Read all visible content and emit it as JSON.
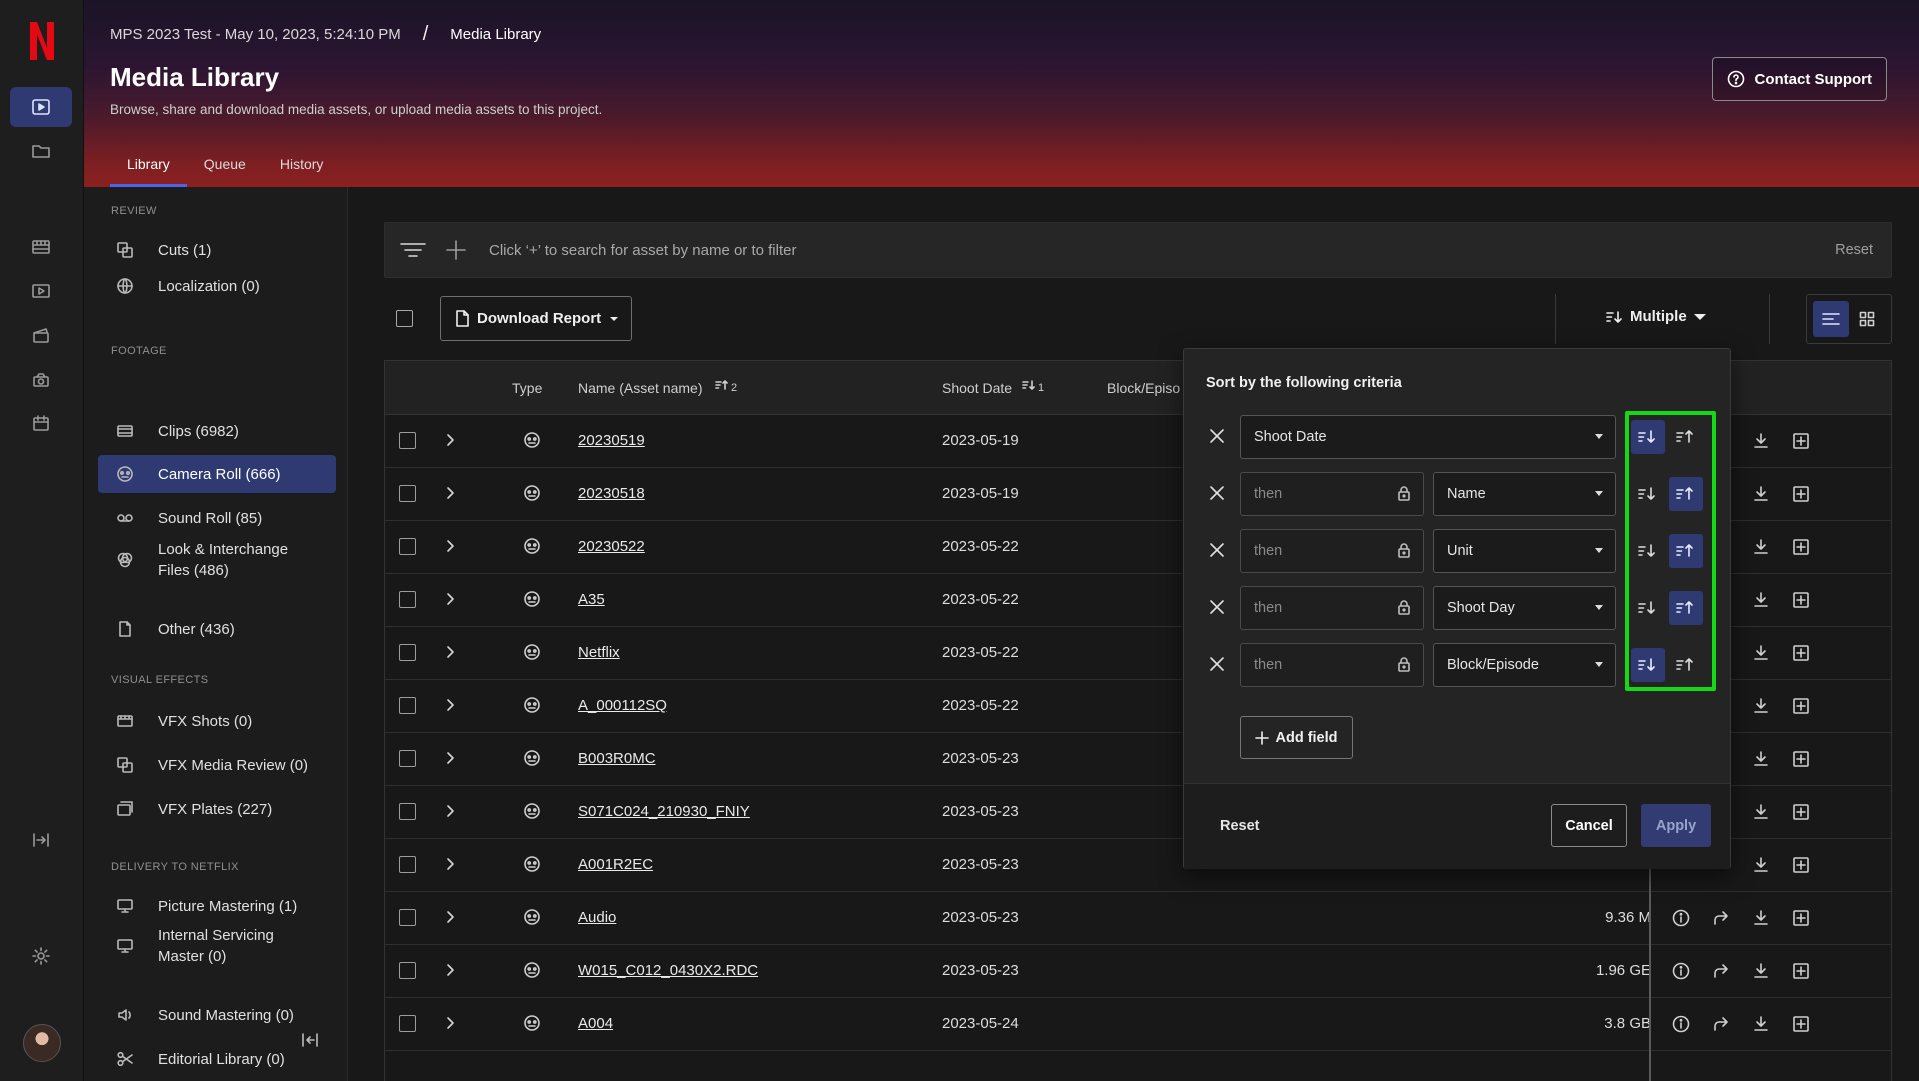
{
  "breadcrumb": {
    "project": "MPS 2023 Test - May 10, 2023, 5:24:10 PM",
    "separator": "/",
    "current": "Media Library"
  },
  "page": {
    "title": "Media Library",
    "subtitle": "Browse, share and download media assets, or upload media assets to this project."
  },
  "tabs": [
    {
      "label": "Library",
      "active": true
    },
    {
      "label": "Queue"
    },
    {
      "label": "History"
    }
  ],
  "contact_support": "Contact Support",
  "sidebar": {
    "review_label": "REVIEW",
    "cuts": "Cuts (1)",
    "localization": "Localization (0)",
    "footage_label": "FOOTAGE",
    "clips": "Clips (6982)",
    "camera_roll": "Camera Roll (666)",
    "sound_roll": "Sound Roll (85)",
    "look_files": "Look & Interchange Files (486)",
    "other": "Other (436)",
    "vfx_label": "VISUAL EFFECTS",
    "vfx_shots": "VFX Shots (0)",
    "vfx_media_review": "VFX Media Review (0)",
    "vfx_plates": "VFX Plates (227)",
    "delivery_label": "DELIVERY TO NETFLIX",
    "picture_mastering": "Picture Mastering (1)",
    "internal_servicing": "Internal Servicing Master (0)",
    "sound_mastering": "Sound Mastering (0)",
    "editorial_library": "Editorial Library (0)"
  },
  "search": {
    "placeholder": "Click ‘+’ to search for asset by name or to filter",
    "reset": "Reset"
  },
  "toolbar": {
    "download_report": "Download Report",
    "sort": "Multiple"
  },
  "table": {
    "headers": {
      "type": "Type",
      "name": "Name (Asset name)",
      "name_sort": "2",
      "shoot_date": "Shoot Date",
      "shoot_date_sort": "1",
      "block": "Block/Episo"
    },
    "rows": [
      {
        "name": "20230519",
        "date": "2023-05-19",
        "size": ""
      },
      {
        "name": "20230518",
        "date": "2023-05-19",
        "size": ""
      },
      {
        "name": "20230522",
        "date": "2023-05-22",
        "size": ""
      },
      {
        "name": "A35",
        "date": "2023-05-22",
        "size": ""
      },
      {
        "name": "Netflix",
        "date": "2023-05-22",
        "size": ""
      },
      {
        "name": "A_000112SQ",
        "date": "2023-05-22",
        "size": ""
      },
      {
        "name": "B003R0MC",
        "date": "2023-05-23",
        "size": ""
      },
      {
        "name": "S071C024_210930_FNIY",
        "date": "2023-05-23",
        "size": ""
      },
      {
        "name": "A001R2EC",
        "date": "2023-05-23",
        "size": ""
      },
      {
        "name": "Audio",
        "date": "2023-05-23",
        "size": "9.36 M"
      },
      {
        "name": "W015_C012_0430X2.RDC",
        "date": "2023-05-23",
        "size": "1.96 GE"
      },
      {
        "name": "A004",
        "date": "2023-05-24",
        "size": "3.8 GB"
      }
    ]
  },
  "sort_popover": {
    "title": "Sort by the following criteria",
    "then_placeholder": "then",
    "criteria": [
      {
        "field": "Shoot Date",
        "order": "descending"
      },
      {
        "field": "Name",
        "order": "ascending"
      },
      {
        "field": "Unit",
        "order": "ascending"
      },
      {
        "field": "Shoot Day",
        "order": "ascending"
      },
      {
        "field": "Block/Episode",
        "order": "descending"
      }
    ],
    "add_field": "Add field",
    "reset": "Reset",
    "cancel": "Cancel",
    "apply": "Apply"
  },
  "colors": {
    "accent": "#2f3a73",
    "highlight": "#16d916",
    "brand_red": "#e50914"
  }
}
